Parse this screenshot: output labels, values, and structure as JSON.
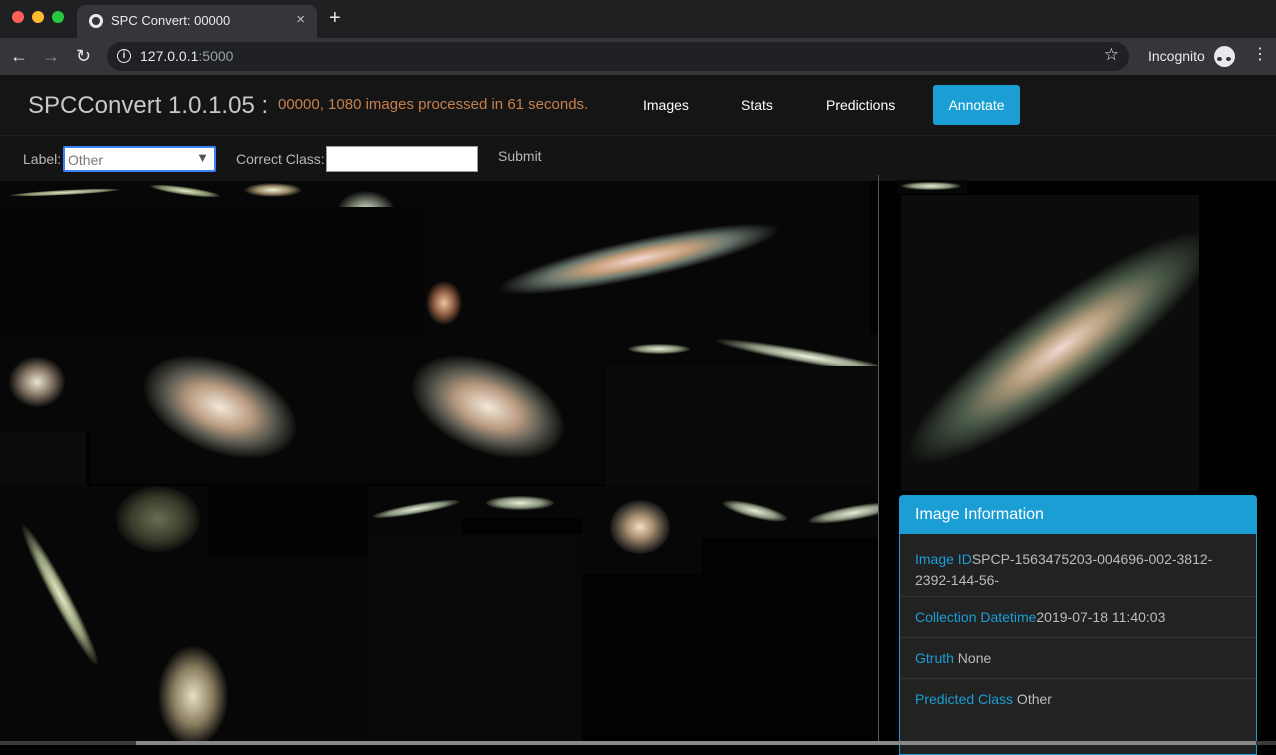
{
  "browser": {
    "tab_title": "SPC Convert: 00000",
    "tab_close": "×",
    "new_tab": "+",
    "back": "←",
    "forward": "→",
    "reload": "↻",
    "info": "i",
    "url_host": "127.0.0.1",
    "url_port": ":5000",
    "star": "☆",
    "incognito_label": "Incognito",
    "menu": "⋮"
  },
  "app": {
    "brand": "SPCConvert 1.0.1.05 :",
    "status": "00000, 1080 images processed in 61 seconds.",
    "nav": {
      "images": "Images",
      "stats": "Stats",
      "predictions": "Predictions",
      "annotate": "Annotate"
    },
    "accent": "#1a9ed4",
    "status_color": "#c7804d"
  },
  "labelbar": {
    "label": "Label:",
    "select_value": "Other",
    "select_arrow": "▼",
    "correct_class_label": "Correct Class:",
    "correct_class_value": "",
    "submit": "Submit"
  },
  "info_panel": {
    "title": "Image Information",
    "rows": [
      {
        "key": "Image ID",
        "value": "SPCP-1563475203-004696-002-3812-2392-144-56-"
      },
      {
        "key": "Collection Datetime",
        "value": "2019-07-18 11:40:03"
      },
      {
        "key": "Gtruth",
        "value": " None"
      },
      {
        "key": "Predicted Class",
        "value": " Other"
      }
    ]
  }
}
